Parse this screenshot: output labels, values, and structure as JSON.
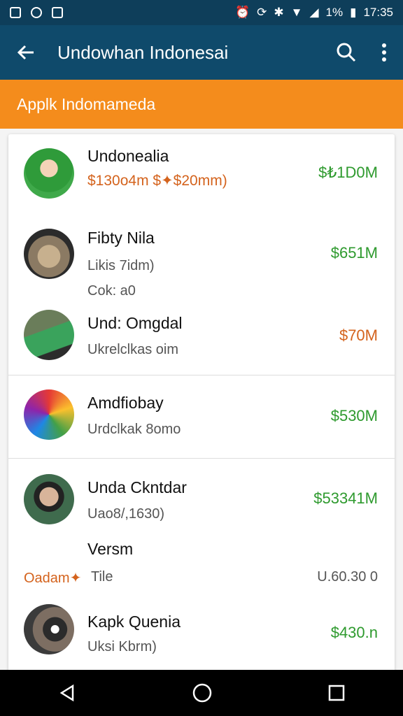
{
  "status": {
    "battery": "1%",
    "time": "17:35"
  },
  "appbar": {
    "title": "Undowhan Indonesai"
  },
  "banner": {
    "text": "Applk Indomameda"
  },
  "rows": [
    {
      "name": "Undonealia",
      "sub": "$130o4m $✦$20mm)",
      "value": "$₺1D0M"
    },
    {
      "name": "Fibty Nila",
      "sub": "Likis 7idm)",
      "sub2": "Cok: a0",
      "value": "$651M"
    },
    {
      "name": "Und: Omgdal",
      "sub": "Ukrelclkas oim",
      "value": "$70M"
    },
    {
      "name": "Amdfiobay",
      "sub": "Urdclkak 8omo",
      "value": "$530M"
    },
    {
      "name": "Unda Ckntdar",
      "sub": "Uao8/,1630)",
      "value": "$53341M"
    },
    {
      "name": "Versm",
      "left": "Oadam✦",
      "sub": "Tile",
      "value": "U.60.30 0"
    },
    {
      "name": "Kapk Quenia",
      "sub": "Uksi Kbrm)",
      "value": "$430.n"
    }
  ],
  "colors": {
    "statusbar": "#0e3e5a",
    "appbar": "#0f4a6b",
    "banner": "#f48c1c",
    "green": "#2e9a2e",
    "orange": "#d4631d"
  }
}
